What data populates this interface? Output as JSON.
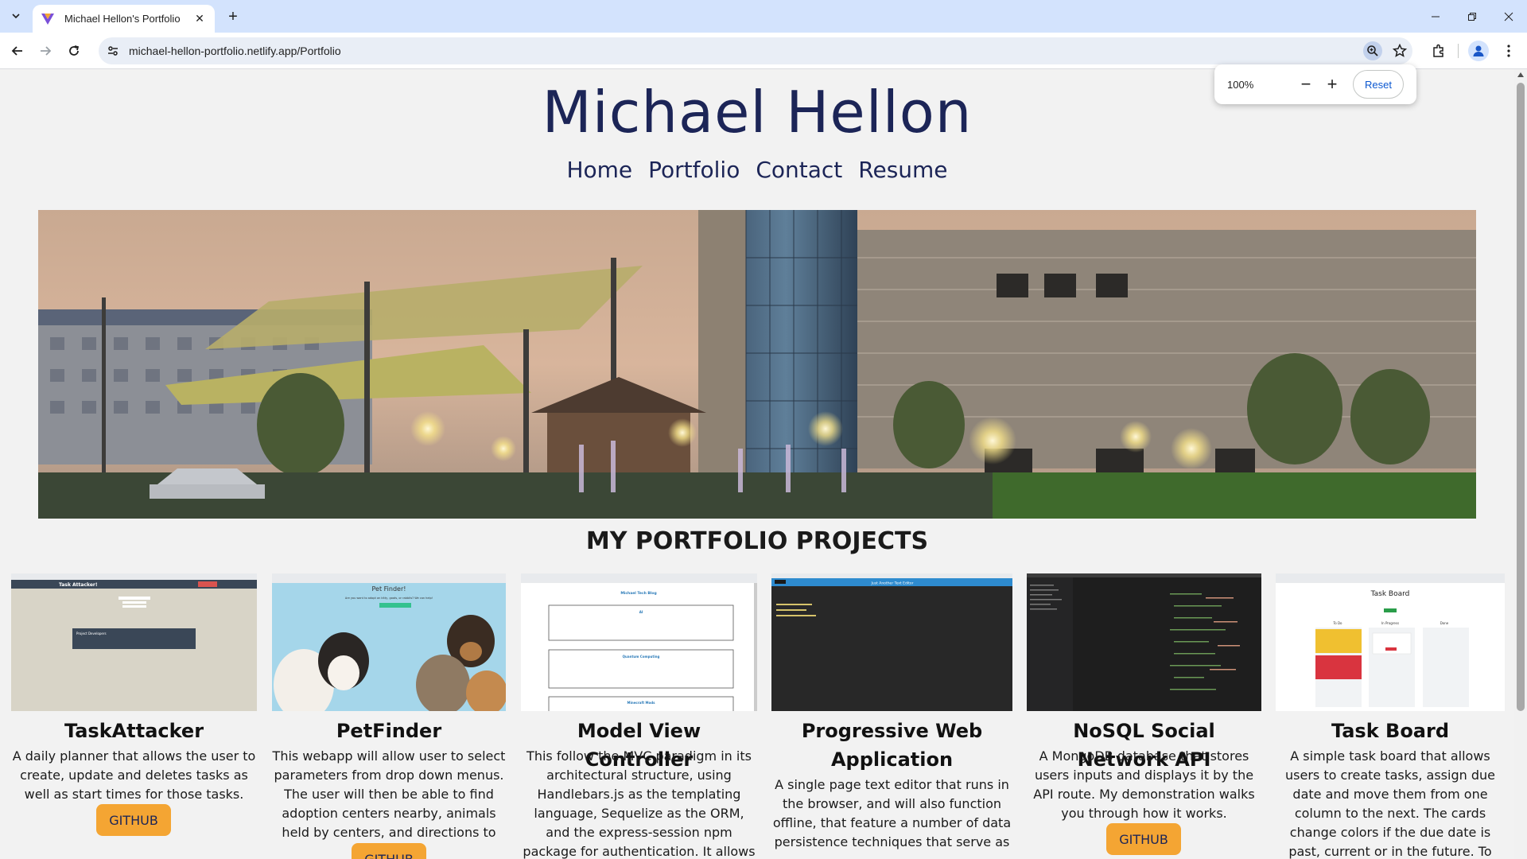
{
  "browser": {
    "tab_title": "Michael Hellon's Portfolio",
    "url": "michael-hellon-portfolio.netlify.app/Portfolio",
    "zoom": {
      "level": "100%",
      "minus": "−",
      "plus": "+",
      "reset": "Reset"
    }
  },
  "site": {
    "title": "Michael Hellon",
    "nav": [
      "Home",
      "Portfolio",
      "Contact",
      "Resume"
    ],
    "section_title": "MY PORTFOLIO PROJECTS"
  },
  "projects": [
    {
      "title": "TaskAttacker",
      "description": "A daily planner that allows the user to create, update and deletes tasks as well as start times for those tasks.",
      "button": "GITHUB"
    },
    {
      "title": "PetFinder",
      "description": "This webapp will allow user to select parameters from drop down menus. The user will then be able to find adoption centers nearby, animals held by centers, and directions to them.",
      "button": "GITHUB"
    },
    {
      "title": "Model View Controller",
      "description": "This follow the MVC paradigm in its architectural structure, using Handlebars.js as the templating language, Sequelize as the ORM, and the express-session npm package for authentication. It allows users to create"
    },
    {
      "title": "Progressive Web Application",
      "description": "A single page text editor that runs in the browser, and will also function offline, that feature a number of data persistence techniques that serve as"
    },
    {
      "title": "NoSQL Social Network API",
      "description": "A MongoDB database that stores users inputs and displays it by the API route. My demonstration walks you through how it works.",
      "button": "GITHUB"
    },
    {
      "title": "Task Board",
      "description": "A simple task board that allows users to create tasks, assign due date and move them from one column to the next. The cards change colors if the due date is past, current or in the future. To view download the code in VSC. Run the html"
    }
  ],
  "thumbnails": {
    "taskattacker": {
      "header": "Task Attacker!",
      "banner": "Project Developers"
    },
    "petfinder": {
      "header": "Pet Finder!",
      "subtitle": "Are you want to adopt an kitty, goats, or rabbits? We can help!"
    },
    "mvc": {
      "header": "Michael Tech Blog",
      "posts": [
        "AI",
        "Quantum Computing",
        "Minecraft Mods"
      ]
    },
    "pwa": {
      "header": "Just Another Text Editor"
    },
    "taskboard": {
      "header": "Task Board",
      "columns": [
        "To Do",
        "In Progress",
        "Done"
      ]
    }
  }
}
